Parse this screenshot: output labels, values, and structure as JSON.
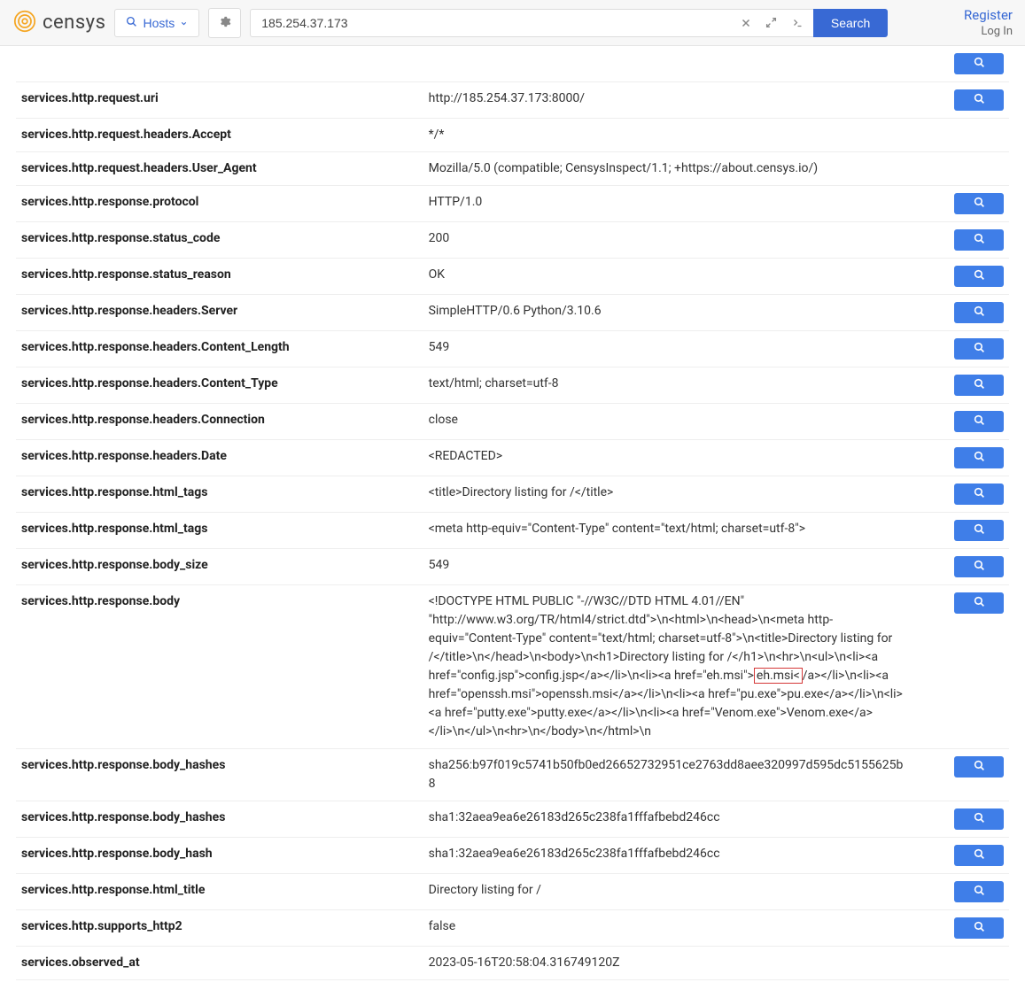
{
  "header": {
    "brand": "censys",
    "hosts_label": "Hosts",
    "search_value": "185.254.37.173",
    "search_btn": "Search",
    "register": "Register",
    "login": "Log In"
  },
  "highlight": "eh.msi<",
  "rows": [
    {
      "key": "services.http.request.uri",
      "val": "http://185.254.37.173:8000/",
      "btn": true
    },
    {
      "key": "services.http.request.headers.Accept",
      "val": "*/*",
      "btn": false
    },
    {
      "key": "services.http.request.headers.User_Agent",
      "val": "Mozilla/5.0 (compatible; CensysInspect/1.1; +https://about.censys.io/)",
      "btn": false
    },
    {
      "key": "services.http.response.protocol",
      "val": "HTTP/1.0",
      "btn": true
    },
    {
      "key": "services.http.response.status_code",
      "val": "200",
      "btn": true
    },
    {
      "key": "services.http.response.status_reason",
      "val": "OK",
      "btn": true
    },
    {
      "key": "services.http.response.headers.Server",
      "val": "SimpleHTTP/0.6 Python/3.10.6",
      "btn": true
    },
    {
      "key": "services.http.response.headers.Content_Length",
      "val": "549",
      "btn": true
    },
    {
      "key": "services.http.response.headers.Content_Type",
      "val": "text/html; charset=utf-8",
      "btn": true
    },
    {
      "key": "services.http.response.headers.Connection",
      "val": "close",
      "btn": true
    },
    {
      "key": "services.http.response.headers.Date",
      "val": "<REDACTED>",
      "btn": true
    },
    {
      "key": "services.http.response.html_tags",
      "val": "<title>Directory listing for /</title>",
      "btn": true
    },
    {
      "key": "services.http.response.html_tags",
      "val": "<meta http-equiv=\"Content-Type\" content=\"text/html; charset=utf-8\">",
      "btn": true
    },
    {
      "key": "services.http.response.body_size",
      "val": "549",
      "btn": true
    },
    {
      "key": "services.http.response.body",
      "val_pre": "<!DOCTYPE HTML PUBLIC \"-//W3C//DTD HTML 4.01//EN\" \"http://www.w3.org/TR/html4/strict.dtd\">\\n<html>\\n<head>\\n<meta http-equiv=\"Content-Type\" content=\"text/html; charset=utf-8\">\\n<title>Directory listing for /</title>\\n</head>\\n<body>\\n<h1>Directory listing for /</h1>\\n<hr>\\n<ul>\\n<li><a href=\"config.jsp\">config.jsp</a></li>\\n<li><a href=\"eh.msi\">",
      "val_post": "/a></li>\\n<li><a href=\"openssh.msi\">openssh.msi</a></li>\\n<li><a href=\"pu.exe\">pu.exe</a></li>\\n<li><a href=\"putty.exe\">putty.exe</a></li>\\n<li><a href=\"Venom.exe\">Venom.exe</a></li>\\n</ul>\\n<hr>\\n</body>\\n</html>\\n",
      "btn": true,
      "highlight": true
    },
    {
      "key": "services.http.response.body_hashes",
      "val": "sha256:b97f019c5741b50fb0ed26652732951ce2763dd8aee320997d595dc5155625b8",
      "btn": true
    },
    {
      "key": "services.http.response.body_hashes",
      "val": "sha1:32aea9ea6e26183d265c238fa1fffafbebd246cc",
      "btn": true
    },
    {
      "key": "services.http.response.body_hash",
      "val": "sha1:32aea9ea6e26183d265c238fa1fffafbebd246cc",
      "btn": true
    },
    {
      "key": "services.http.response.html_title",
      "val": "Directory listing for /",
      "btn": true
    },
    {
      "key": "services.http.supports_http2",
      "val": "false",
      "btn": true
    },
    {
      "key": "services.observed_at",
      "val": "2023-05-16T20:58:04.316749120Z",
      "btn": false
    }
  ]
}
